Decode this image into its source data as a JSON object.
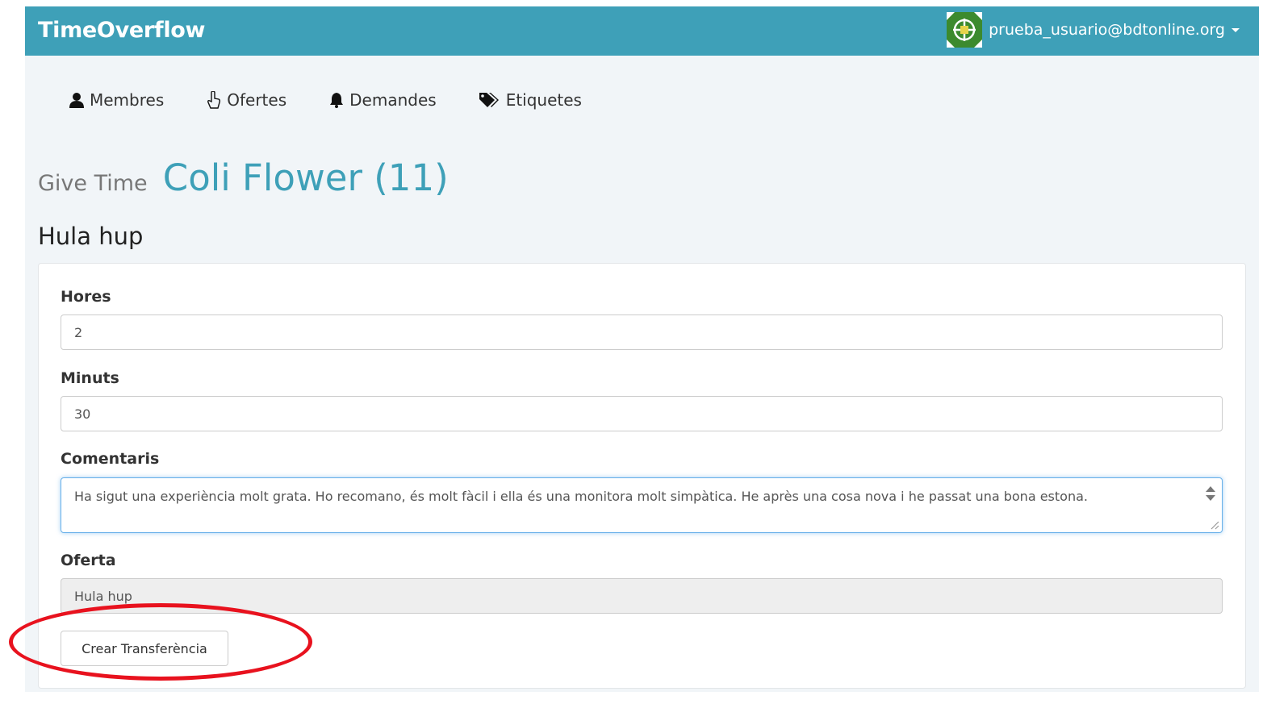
{
  "navbar": {
    "brand": "TimeOverflow",
    "user_email": "prueba_usuario@bdtonline.org",
    "avatar_icon": "organization-logo-icon"
  },
  "subnav": {
    "items": [
      {
        "label": "Membres",
        "icon": "user-icon"
      },
      {
        "label": "Ofertes",
        "icon": "hand-pointer-icon"
      },
      {
        "label": "Demandes",
        "icon": "bell-icon"
      },
      {
        "label": "Etiquetes",
        "icon": "tags-icon"
      }
    ]
  },
  "heading": {
    "action": "Give Time",
    "member": "Coli Flower (11)"
  },
  "subheading": "Hula hup",
  "form": {
    "hours_label": "Hores",
    "hours_value": "2",
    "minutes_label": "Minuts",
    "minutes_value": "30",
    "comments_label": "Comentaris",
    "comments_value": "Ha sigut una experiència molt grata.  Ho recomano, és molt fàcil i ella és una monitora molt simpàtica. He après una cosa nova i he passat una bona estona.",
    "offer_label": "Oferta",
    "offer_value": "Hula hup",
    "submit_label": "Crear Transferència"
  },
  "colors": {
    "brand": "#3ea0b8",
    "annotation": "#e8121e"
  }
}
